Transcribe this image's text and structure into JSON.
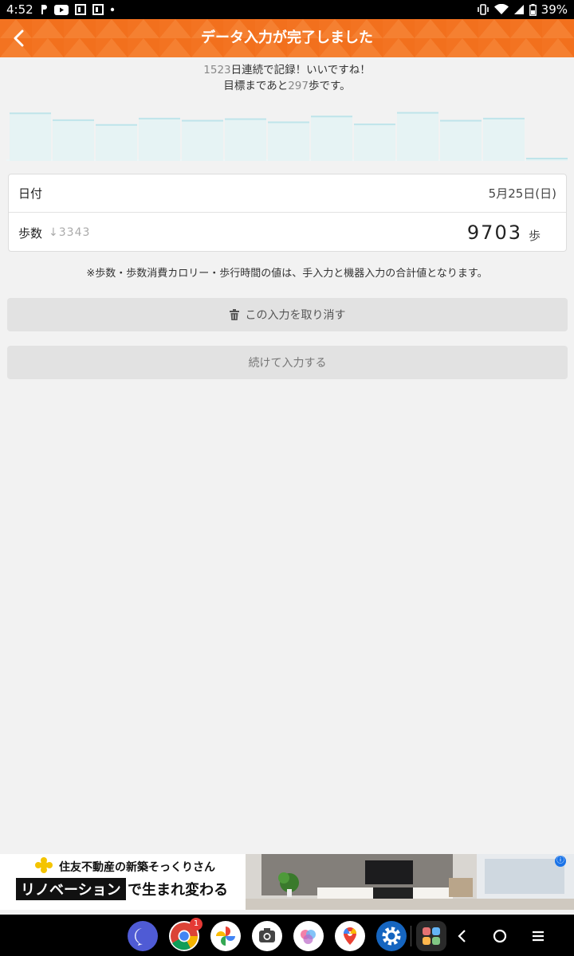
{
  "status_bar": {
    "time": "4:52",
    "battery": "39%",
    "left_icons": [
      "p-icon",
      "youtube-icon",
      "gallery-icon",
      "gallery-icon",
      "dot-icon"
    ],
    "right_icons": [
      "vibrate-icon",
      "wifi-icon",
      "signal-icon",
      "battery-icon"
    ]
  },
  "header": {
    "title": "データ入力が完了しました",
    "color": "#f37321"
  },
  "message": {
    "line1_days": "1523",
    "line1_text": "日連続で記録！いいですね！",
    "line2_prefix": "目標まであと",
    "line2_steps": "297",
    "line2_suffix": "歩です。"
  },
  "chart_data": {
    "type": "bar",
    "categories": [
      "",
      "",
      "",
      "",
      "",
      "",
      "",
      "",
      "",
      "",
      "",
      "",
      ""
    ],
    "values": [
      0.92,
      0.79,
      0.7,
      0.82,
      0.78,
      0.81,
      0.75,
      0.86,
      0.71,
      0.93,
      0.78,
      0.82,
      0.06
    ],
    "colors": {
      "fill": "#e6f3f4",
      "top": "#bfe4ea"
    }
  },
  "card": {
    "date_label": "日付",
    "date_value": "5月25日(日)",
    "steps_label": "歩数",
    "prev_arrow": "↓",
    "prev_value": "3343",
    "steps_value": "9703",
    "steps_unit": "歩"
  },
  "note": "※歩数・歩数消費カロリー・歩行時間の値は、手入力と機器入力の合計値となります。",
  "buttons": {
    "undo_label": "この入力を取り消す",
    "continue_label": "続けて入力する"
  },
  "ad": {
    "brand": "住友不動産の新築そっくりさん",
    "boxed_text": "リノベーション",
    "rest_text": "で生まれ変わる",
    "info_icon": "ⓘ"
  },
  "taskbar": {
    "apps": [
      "messenger-icon",
      "chrome-icon",
      "photos-icon",
      "camera-icon",
      "app-icon",
      "maps-icon",
      "settings-icon",
      "app-drawer-icon"
    ],
    "chrome_badge": "1",
    "nav": [
      "back-nav-icon",
      "home-nav-icon",
      "recents-nav-icon"
    ]
  }
}
